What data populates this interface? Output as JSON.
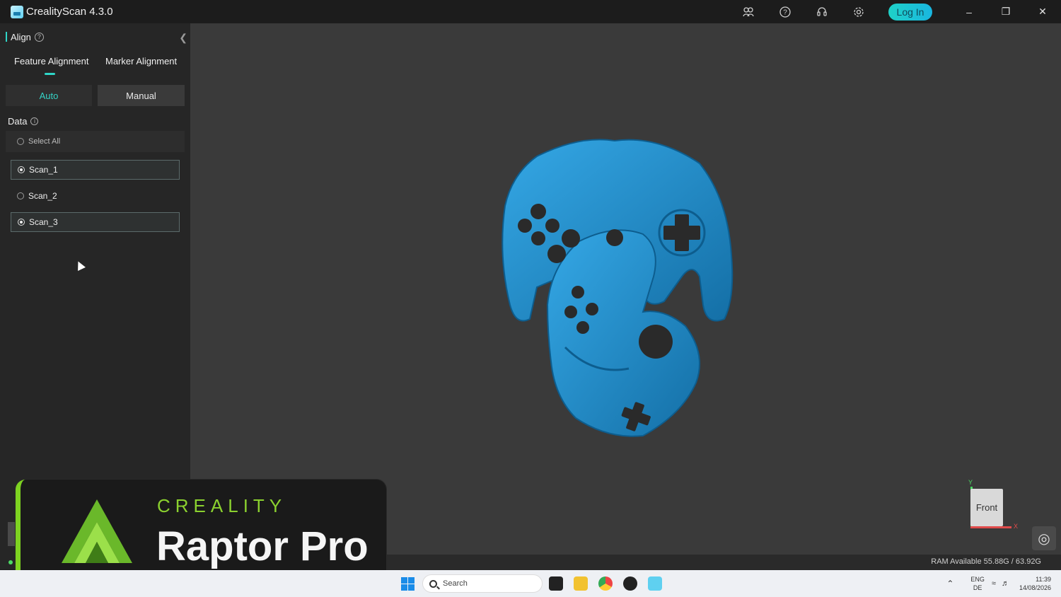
{
  "window": {
    "title": "CrealityScan 4.3.0",
    "login_label": "Log In"
  },
  "icons": {
    "community": "community-icon",
    "help": "help-icon",
    "support": "headset-icon",
    "settings": "gear-icon",
    "minimize": "minimize-icon",
    "restore": "restore-icon",
    "close": "close-icon"
  },
  "panel": {
    "title": "Align",
    "tabs": [
      "Feature Alignment",
      "Marker Alignment"
    ],
    "modes": {
      "auto": "Auto",
      "manual": "Manual"
    },
    "data_label": "Data",
    "select_all": "Select All",
    "scans": [
      {
        "label": "Scan_1",
        "selected": true
      },
      {
        "label": "Scan_2",
        "selected": false
      },
      {
        "label": "Scan_3",
        "selected": true
      }
    ]
  },
  "viewport": {
    "view_label": "Front",
    "axis_y": "Y",
    "axis_x": "X",
    "ram": "RAM Available 55.88G / 63.92G",
    "model_color": "#1c93d0"
  },
  "brand": {
    "subtitle": "CREALITY",
    "title": "Raptor Pro",
    "accent": "#7ed321"
  },
  "taskbar": {
    "search_placeholder": "Search",
    "lang_top": "ENG",
    "lang_bottom": "DE",
    "time": "11:39",
    "date": "14/08/2026"
  }
}
